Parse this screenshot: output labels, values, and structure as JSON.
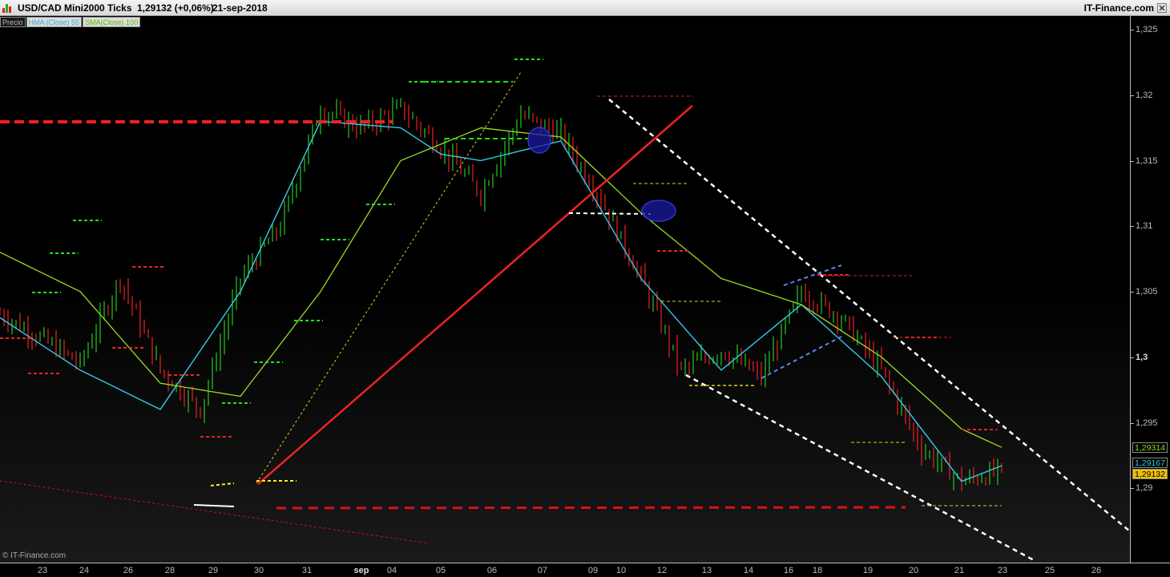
{
  "window": {
    "symbol": "USD/CAD Mini",
    "ticks": "2000 Ticks",
    "quote": "1,29132 (+0,06%)",
    "date": "21-sep-2018",
    "brand": "IT-Finance.com"
  },
  "legend": {
    "price": "Precio",
    "hull": "HMA (Close) 55",
    "sma": "SMA(Close) 100"
  },
  "watermark": "© IT-Finance.com",
  "icons": {
    "app": "bar-chart-icon",
    "close": "close-icon"
  },
  "colors": {
    "up": "#22cc22",
    "down": "#ee2222",
    "hull": "#33ccee",
    "sma": "#99dd22",
    "title_bg": "#e4e4e4"
  },
  "price_boxes": [
    {
      "value": "1,29314",
      "bg": "#000000",
      "fg": "#99dd22"
    },
    {
      "value": "1,29167",
      "bg": "#000000",
      "fg": "#33ccee"
    },
    {
      "value": "1,29132",
      "bg": "#f0c000",
      "fg": "#000000"
    }
  ],
  "chart_data": {
    "type": "line",
    "title": "USD/CAD Mini 2000 Ticks",
    "ylim": [
      1.2855,
      1.3255
    ],
    "y_ticks": [
      "1,325",
      "1,32",
      "1,315",
      "1,31",
      "1,305",
      "1,3",
      "1,295",
      "1,29"
    ],
    "x_ticks": [
      "23",
      "24",
      "26",
      "28",
      "29",
      "30",
      "31",
      "sep",
      "04",
      "05",
      "06",
      "07",
      "09",
      "10",
      "12",
      "13",
      "14",
      "16",
      "18",
      "19",
      "20",
      "21",
      "23",
      "25",
      "26"
    ],
    "series": [
      {
        "name": "Precio",
        "x": [
          0,
          10,
          20,
          30,
          40,
          50,
          60,
          70,
          80,
          90,
          100,
          110,
          120,
          130,
          140,
          150,
          160,
          170,
          180,
          190,
          200,
          210,
          220,
          230,
          240,
          250
        ],
        "values": [
          1.3033,
          1.3015,
          1.2995,
          1.306,
          1.299,
          1.296,
          1.306,
          1.31,
          1.319,
          1.3175,
          1.319,
          1.316,
          1.3125,
          1.3185,
          1.317,
          1.312,
          1.306,
          1.299,
          1.3005,
          1.2985,
          1.305,
          1.303,
          1.299,
          1.293,
          1.2905,
          1.2913
        ]
      },
      {
        "name": "HMA (Close) 55",
        "x": [
          0,
          20,
          40,
          60,
          80,
          100,
          110,
          120,
          140,
          160,
          180,
          200,
          220,
          240,
          250
        ],
        "values": [
          1.303,
          1.299,
          1.296,
          1.305,
          1.318,
          1.3175,
          1.3155,
          1.315,
          1.3165,
          1.306,
          1.299,
          1.304,
          1.2985,
          1.2905,
          1.2917
        ]
      },
      {
        "name": "SMA(Close) 100",
        "x": [
          0,
          20,
          40,
          60,
          80,
          100,
          120,
          140,
          160,
          180,
          200,
          220,
          240,
          250
        ],
        "values": [
          1.308,
          1.305,
          1.298,
          1.297,
          1.305,
          1.315,
          1.3175,
          1.3168,
          1.311,
          1.306,
          1.304,
          1.3,
          1.2945,
          1.2931
        ]
      }
    ],
    "grid": false,
    "annotations": {
      "support_line_red_dashed": [
        1.3181,
        1.2885
      ],
      "uptrend_line": "red solid",
      "downtrend_channel": "white dashed",
      "highlights": "blue ellipses"
    }
  }
}
